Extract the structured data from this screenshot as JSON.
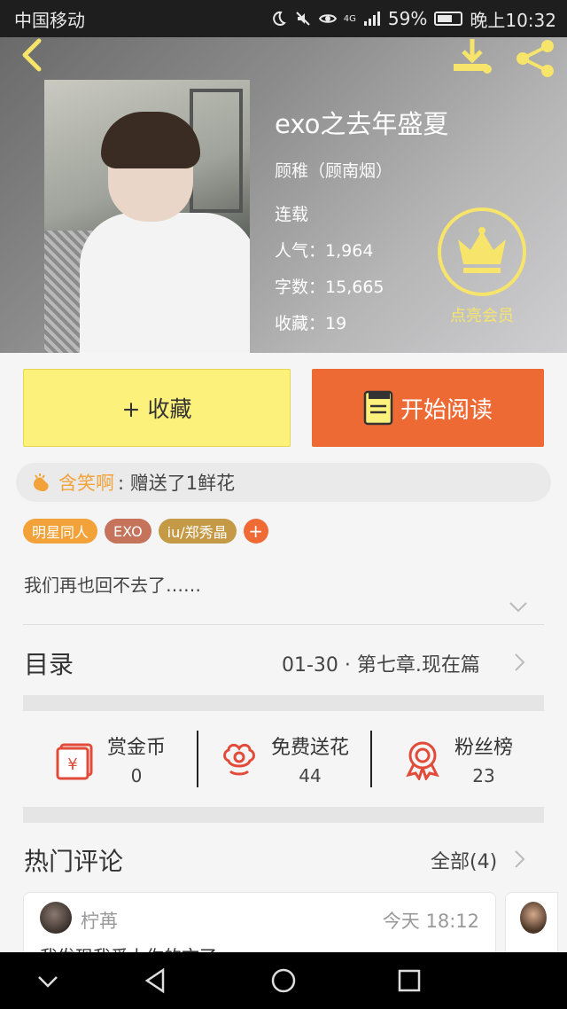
{
  "status_bar": {
    "carrier": "中国移动",
    "signal_badge": "4G",
    "battery": "59%",
    "time": "晚上10:32"
  },
  "book": {
    "title": "exo之去年盛夏",
    "author": "顾稚（顾南烟）",
    "status": "连载",
    "popularity_label": "人气：",
    "popularity": "1,964",
    "word_count_label": "字数：",
    "word_count": "15,665",
    "favorites_label": "收藏：",
    "favorites": "19",
    "description": "我们再也回不去了……"
  },
  "vip": {
    "label": "点亮会员"
  },
  "actions": {
    "collect": "+ 收藏",
    "read": "开始阅读"
  },
  "gift": {
    "user": "含笑啊",
    "message": ": 赠送了1鲜花"
  },
  "tags": [
    {
      "label": "明星同人",
      "color": "#f2a238"
    },
    {
      "label": "EXO",
      "color": "#c5735a"
    },
    {
      "label": "iu/郑秀晶",
      "color": "#c49a46"
    }
  ],
  "toc": {
    "label": "目录",
    "chapter": "01-30 · 第七章.现在篇"
  },
  "stats": [
    {
      "label": "赏金币",
      "value": "0",
      "icon": "reward-coin-icon"
    },
    {
      "label": "免费送花",
      "value": "44",
      "icon": "flower-icon"
    },
    {
      "label": "粉丝榜",
      "value": "23",
      "icon": "ribbon-medal-icon"
    }
  ],
  "comments": {
    "label": "热门评论",
    "all": "全部(4)",
    "items": [
      {
        "name": "柠苒",
        "time": "今天 18:12",
        "text": "我发现我爱上你的文了"
      }
    ]
  },
  "colors": {
    "accent_orange": "#ee6a35",
    "collect_yellow": "#fcf17a",
    "crown_yellow": "#f7e46a"
  }
}
